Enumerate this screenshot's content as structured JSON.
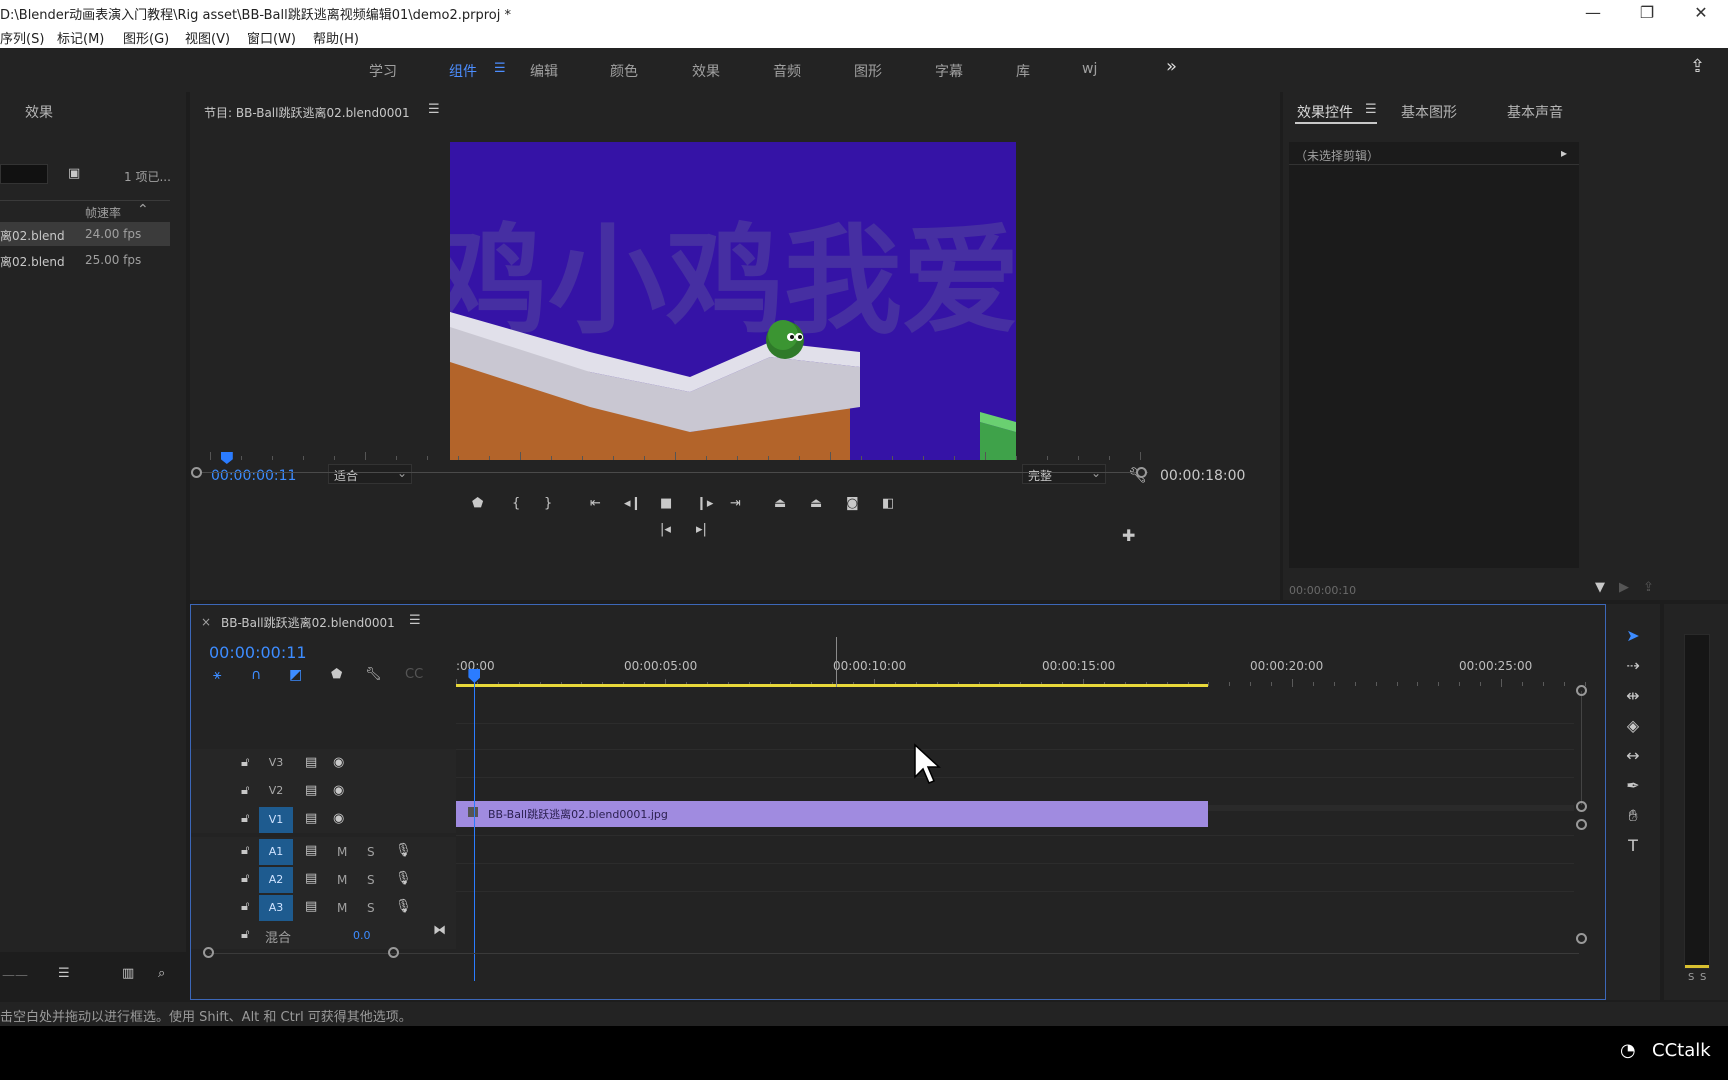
{
  "window": {
    "title": "D:\\Blender动画表演入门教程\\Rig asset\\BB-Ball跳跃逃离视频编辑01\\demo2.prproj *",
    "minimize": "—",
    "restore": "❐",
    "close": "✕"
  },
  "menu": [
    "序列(S)",
    "标记(M)",
    "图形(G)",
    "视图(V)",
    "窗口(W)",
    "帮助(H)"
  ],
  "workspaces": {
    "items": [
      "学习",
      "组件",
      "编辑",
      "颜色",
      "效果",
      "音频",
      "图形",
      "字幕",
      "库",
      "wj"
    ],
    "active": "组件",
    "more": "»"
  },
  "project_panel": {
    "tab": "效果",
    "item_count": "1 项已...",
    "column_header": "帧速率",
    "rows": [
      {
        "name": "离02.blend",
        "fps": "24.00 fps"
      },
      {
        "name": "离02.blend",
        "fps": "25.00 fps"
      }
    ]
  },
  "program_monitor": {
    "title": "节目: BB-Ball跳跃逃离02.blend0001",
    "timecode": "00:00:00:11",
    "fit": "适合",
    "quality": "完整",
    "duration": "00:00:18:00",
    "playhead_fraction": 0.02,
    "preview_text": "鸡小鸡我爱"
  },
  "effect_controls": {
    "tabs": [
      "效果控件",
      "基本图形",
      "基本声音"
    ],
    "active_tab": "效果控件",
    "no_clip": "（未选择剪辑）",
    "timecode": "00:00:00:10"
  },
  "timeline": {
    "sequence_name": "BB-Ball跳跃逃离02.blend0001",
    "timecode": "00:00:00:11",
    "ruler": [
      ":00:00",
      "00:00:05:00",
      "00:00:10:00",
      "00:00:15:00",
      "00:00:20:00",
      "00:00:25:00"
    ],
    "video_tracks": [
      "V3",
      "V2",
      "V1"
    ],
    "audio_tracks": [
      "A1",
      "A2",
      "A3"
    ],
    "mute_label": "M",
    "solo_label": "S",
    "mix_label": "混合",
    "mix_value": "0.0",
    "clip_name": "BB-Ball跳跃逃离02.blend0001.jpg",
    "clip_color": "#a08be0",
    "clip_end_seconds": 18
  },
  "audio_meter": {
    "labels": [
      "S",
      "S"
    ]
  },
  "status_bar": "击空白处并拖动以进行框选。使用 Shift、Alt 和 Ctrl 可获得其他选项。",
  "watermark": "CCtalk"
}
